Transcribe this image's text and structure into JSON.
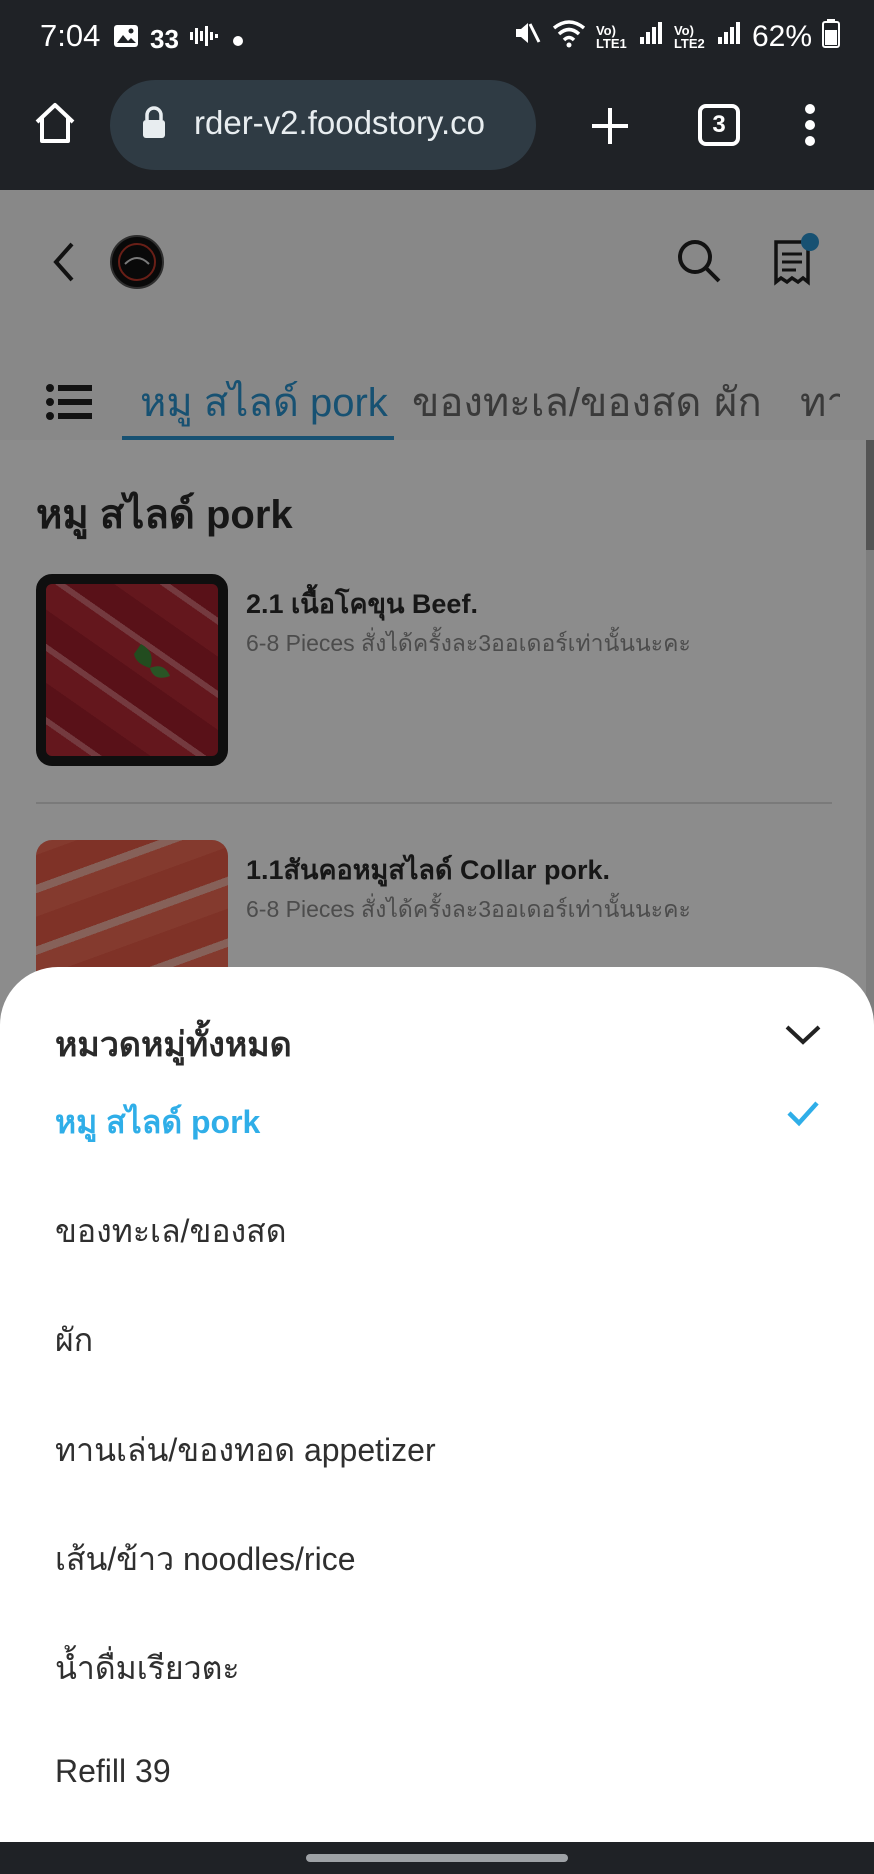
{
  "status_bar": {
    "time": "7:04",
    "notification_count": "33",
    "battery": "62%",
    "sim1": "Vo) LTE1",
    "sim2": "Vo) LTE2"
  },
  "browser": {
    "url": "rder-v2.foodstory.co",
    "tab_count": "3"
  },
  "category_tabs": [
    {
      "label": "หมู สไลด์ pork",
      "active": true
    },
    {
      "label": "ของทะเล/ของสด",
      "active": false
    },
    {
      "label": "ผัก",
      "active": false
    },
    {
      "label": "ทา",
      "active": false
    }
  ],
  "section": {
    "title": "หมู สไลด์ pork"
  },
  "menu_items": [
    {
      "name": "2.1 เนื้อโคขุน Beef.",
      "description": "6-8 Pieces สั่งได้ครั้งละ3ออเดอร์เท่านั้นนะคะ"
    },
    {
      "name": "1.1สันคอหมูสไลด์ Collar pork.",
      "description": "6-8 Pieces สั่งได้ครั้งละ3ออเดอร์เท่านั้นนะคะ"
    }
  ],
  "category_sheet": {
    "title": "หมวดหมู่ทั้งหมด",
    "items": [
      {
        "label": "หมู สไลด์ pork",
        "selected": true
      },
      {
        "label": "ของทะเล/ของสด",
        "selected": false
      },
      {
        "label": "ผัก",
        "selected": false
      },
      {
        "label": "ทานเล่น/ของทอด appetizer",
        "selected": false
      },
      {
        "label": "เส้น/ข้าว noodles/rice",
        "selected": false
      },
      {
        "label": "น้ำดื่มเรียวตะ",
        "selected": false
      },
      {
        "label": "Refill 39",
        "selected": false
      }
    ]
  },
  "colors": {
    "accent": "#2faee8",
    "tab_active": "#2b94cf",
    "status_bar_bg": "#1f2226",
    "url_pill_bg": "#2f3b44",
    "badge": "#2b94cf"
  },
  "icons": {
    "back": "chevron-left-icon",
    "search": "search-icon",
    "orders": "receipt-icon",
    "menu": "list-menu-icon",
    "collapse": "chevron-down-icon",
    "selected": "check-icon"
  }
}
